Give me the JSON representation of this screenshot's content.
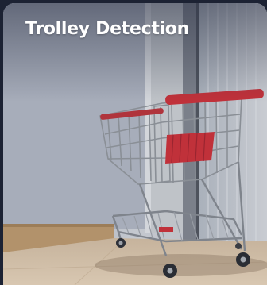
{
  "card": {
    "title": "Trolley Detection",
    "image_subject": "shopping-trolley-photo"
  },
  "colors": {
    "page_background": "#1c2233",
    "title_text": "#ffffff",
    "trolley_red": "#c0313a"
  }
}
